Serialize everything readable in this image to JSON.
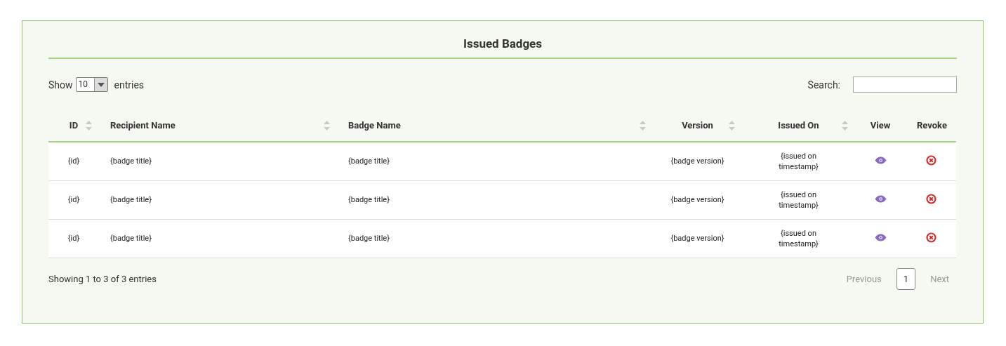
{
  "title": "Issued Badges",
  "length_menu": {
    "before": "Show",
    "value": "10",
    "after": "entries"
  },
  "search": {
    "label": "Search:"
  },
  "table": {
    "columns": [
      {
        "label": "ID",
        "sortable": true
      },
      {
        "label": "Recipient Name",
        "sortable": true
      },
      {
        "label": "Badge Name",
        "sortable": true
      },
      {
        "label": "Version",
        "sortable": true
      },
      {
        "label": "Issued On",
        "sortable": true
      },
      {
        "label": "View",
        "sortable": false
      },
      {
        "label": "Revoke",
        "sortable": false
      }
    ],
    "rows": [
      {
        "id": "{id}",
        "recipient": "{badge title}",
        "badge": "{badge title}",
        "version": "{badge version}",
        "issued_on": "{issued on timestamp}"
      },
      {
        "id": "{id}",
        "recipient": "{badge title}",
        "badge": "{badge title}",
        "version": "{badge version}",
        "issued_on": "{issued on timestamp}"
      },
      {
        "id": "{id}",
        "recipient": "{badge title}",
        "badge": "{badge title}",
        "version": "{badge version}",
        "issued_on": "{issued on timestamp}"
      }
    ]
  },
  "info": "Showing 1 to 3 of 3 entries",
  "pagination": [
    {
      "label": "Previous",
      "disabled": true,
      "selected": false
    },
    {
      "label": "1",
      "disabled": false,
      "selected": true
    },
    {
      "label": "Next",
      "disabled": true,
      "selected": false
    }
  ]
}
